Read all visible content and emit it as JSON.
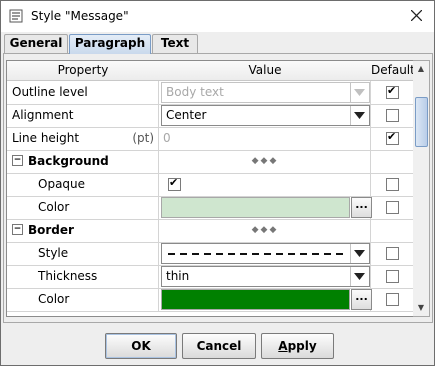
{
  "window": {
    "title": "Style \"Message\""
  },
  "tabs": [
    {
      "label": "General",
      "active": false
    },
    {
      "label": "Paragraph",
      "active": true
    },
    {
      "label": "Text",
      "active": false
    }
  ],
  "table": {
    "columns": [
      "Property",
      "Value",
      "Default"
    ],
    "rows": [
      {
        "label": "Outline level",
        "value": "Body text",
        "control": "combo",
        "disabled": true,
        "default": true
      },
      {
        "label": "Alignment",
        "value": "Center",
        "control": "combo",
        "disabled": false,
        "default": false
      },
      {
        "label": "Line height",
        "unit": "(pt)",
        "value": "0",
        "control": "text",
        "disabled": true,
        "default": true
      },
      {
        "label": "Background",
        "section": true,
        "expander": "−"
      },
      {
        "label": "Opaque",
        "control": "checkbox",
        "checked": true,
        "default": false
      },
      {
        "label": "Color",
        "control": "color",
        "color": "#cfe6cf",
        "button": "...",
        "default": false
      },
      {
        "label": "Border",
        "section": true,
        "expander": "−"
      },
      {
        "label": "Style",
        "control": "combo-dashed",
        "default": false
      },
      {
        "label": "Thickness",
        "value": "thin",
        "control": "combo",
        "default": false
      },
      {
        "label": "Color",
        "control": "color",
        "color": "#008000",
        "button": "...",
        "default": false
      }
    ]
  },
  "buttons": {
    "ok": "OK",
    "cancel": "Cancel",
    "apply_prefix": "A",
    "apply_rest": "pply"
  },
  "colors": {
    "background_color": "#cfe6cf",
    "border_color": "#008000",
    "accent": "#7a9cc6"
  }
}
